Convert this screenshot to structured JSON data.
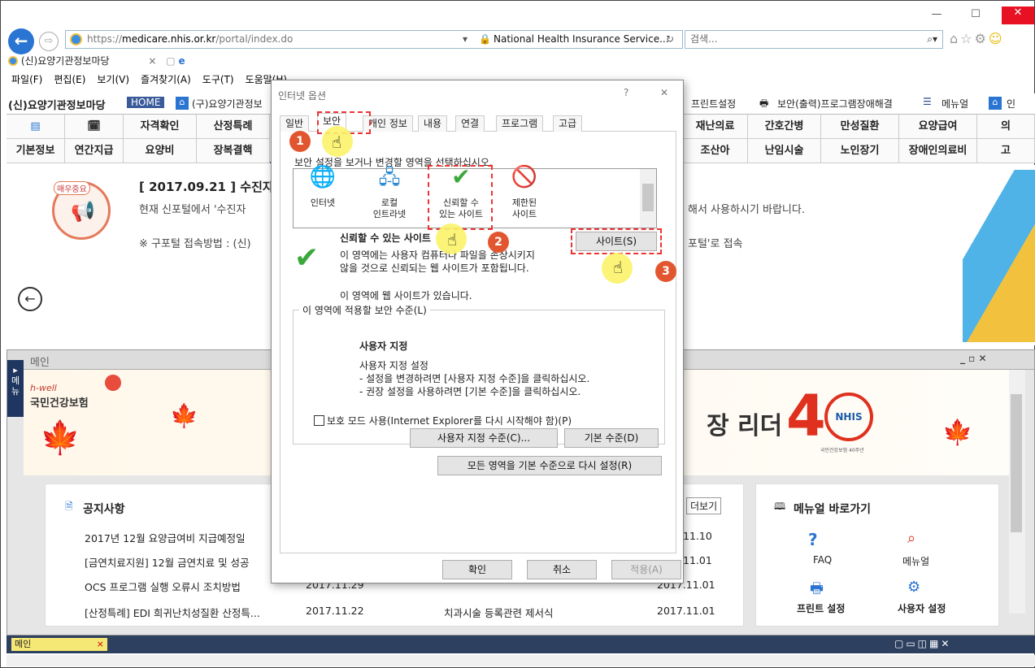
{
  "window": {
    "minimize": "—",
    "maximize": "☐",
    "close": "✕"
  },
  "address": {
    "scheme": "https://",
    "host": "medicare.nhis.or.kr",
    "path": "/portal/index.do",
    "site_identity": "National Health Insurance Service...",
    "search_placeholder": "검색..."
  },
  "tab": {
    "title": "(신)요양기관정보마당"
  },
  "menu": [
    "파일(F)",
    "편집(E)",
    "보기(V)",
    "즐겨찾기(A)",
    "도구(T)",
    "도움말(H)"
  ],
  "site": {
    "brand": "(신)요양기관정보마당",
    "home": "HOME",
    "old_portal": "(구)요양기관정보",
    "util": [
      "프린트설정",
      "보안(출력)프로그램장애해결",
      "메뉴얼",
      "인"
    ],
    "nav_left": [
      "기본정보",
      "연간지급"
    ],
    "nav_top": [
      "자격확인",
      "산정특례"
    ],
    "nav_bottom": [
      "요양비",
      "장복결핵"
    ],
    "nav_right_top": [
      "재난의료",
      "간호간병",
      "만성질환",
      "요양급여",
      "의"
    ],
    "nav_right_bottom": [
      "조산아",
      "난임시술",
      "노인장기",
      "장애인의료비",
      "고"
    ],
    "notice_tag": "매우중요",
    "notice_title": "[ 2017.09.21 ] 수진자",
    "notice_line1": "현재 신포털에서 '수진자",
    "notice_line1_end": "해서 사용하시기 바랍니다.",
    "notice_line2": "※ 구포털 접속방법 : (신)",
    "notice_line2_end": "포털'로 접속"
  },
  "work": {
    "title": "메인",
    "side_tab": "메뉴",
    "banner_brand": "h-well",
    "banner_org": "국민건강보험",
    "banner_slogan": "장 리더",
    "nhis": "NHIS",
    "nhis_sub": "국민건강보험 40주년",
    "notice_heading": "공지사항",
    "more": "더보기",
    "notices": [
      {
        "title": "2017년 12월 요양급여비 지급예정일",
        "date": "",
        "right_date": "11.10"
      },
      {
        "title": "[금연치료지원] 12월 금연치료 및 성공",
        "date": "",
        "right_date": "11.01"
      },
      {
        "title": "OCS 프로그램 실행 오류시 조치방법",
        "date": "2017.11.29",
        "right_date": "2017.11.01"
      },
      {
        "title": "[산정특례] EDI 희귀난치성질환 산정특...",
        "date": "2017.11.22",
        "right_date": "2017.11.01",
        "right_title": "치과시술 등록관련 제서식"
      }
    ],
    "manual_heading": "메뉴얼 바로가기",
    "shortcuts": [
      {
        "label": "FAQ"
      },
      {
        "label": "메뉴얼"
      },
      {
        "label": "프린트 설정"
      },
      {
        "label": "사용자 설정"
      }
    ],
    "bottom_tab": "메인"
  },
  "dialog": {
    "title": "인터넷 옵션",
    "help": "?",
    "close": "✕",
    "tabs": [
      "일반",
      "보안",
      "개인 정보",
      "내용",
      "연결",
      "프로그램",
      "고급"
    ],
    "instruction": "보안 설정을 보거나 변경할 영역을 선택하십시오.",
    "zones": [
      {
        "label1": "인터넷",
        "label2": ""
      },
      {
        "label1": "로컬",
        "label2": "인트라넷"
      },
      {
        "label1": "신뢰할 수",
        "label2": "있는 사이트"
      },
      {
        "label1": "제한된",
        "label2": "사이트"
      }
    ],
    "zone_heading": "신뢰할 수 있는 사이트",
    "zone_desc1": "이 영역에는 사용자 컴퓨터나 파일을 손상시키지",
    "zone_desc2": "않을 것으로 신뢰되는 웹 사이트가 포함됩니다.",
    "zone_has_sites": "이 영역에 웹 사이트가 있습니다.",
    "sites_button": "사이트(S)",
    "level_group": "이 영역에 적용할 보안 수준(L)",
    "level_name": "사용자 지정",
    "level_l1": "사용자 지정 설정",
    "level_l2": "- 설정을 변경하려면 [사용자 지정 수준]을 클릭하십시오.",
    "level_l3": "- 권장 설정을 사용하려면 [기본 수준]을 클릭하십시오.",
    "protected_mode": "보호 모드 사용(Internet Explorer를 다시 시작해야 함)(P)",
    "custom_level": "사용자 지정 수준(C)...",
    "default_level": "기본 수준(D)",
    "reset_all": "모든 영역을 기본 수준으로 다시 설정(R)",
    "ok": "확인",
    "cancel": "취소",
    "apply": "적용(A)"
  },
  "steps": [
    "1",
    "2",
    "3"
  ],
  "colors": {
    "accent": "#2a74d2",
    "step": "#e2562f",
    "highlight": "#fbf36a",
    "dash": "#e33333"
  }
}
